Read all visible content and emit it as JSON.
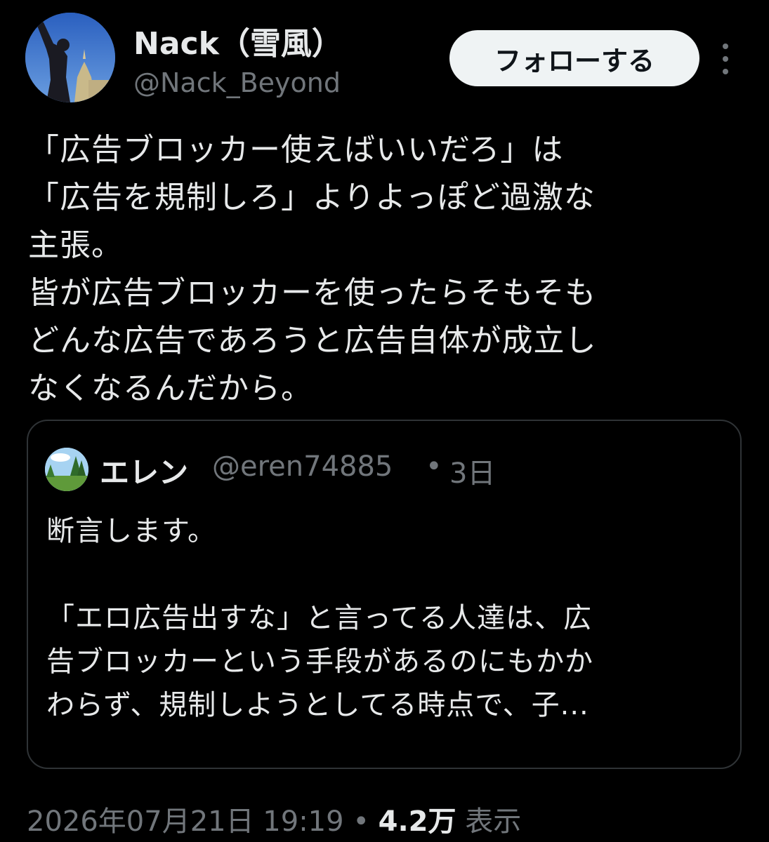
{
  "author": {
    "display_name": "Nack（雪風）",
    "handle": "@Nack_Beyond"
  },
  "follow_button_label": "フォローする",
  "more_icon": "more-vertical-icon",
  "tweet": {
    "lines": [
      "「広告ブロッカー使えばいいだろ」は",
      "「広告を規制しろ」よりよっぽど過激な",
      "主張。",
      "皆が広告ブロッカーを使ったらそもそも",
      "どんな広告であろうと広告自体が成立し",
      "なくなるんだから。"
    ]
  },
  "quote": {
    "display_name": "エレン",
    "handle": "@eren74885",
    "separator": "•",
    "time": "3日",
    "lines": [
      "断言します。",
      "",
      "「エロ広告出すな」と言ってる人達は、広",
      "告ブロッカーという手段があるのにもかか",
      "わらず、規制しようとしてる時点で、子..."
    ]
  },
  "meta": {
    "timestamp": "2026年07月21日 19:19",
    "separator": "•",
    "views_count": "4.2万",
    "views_label": "表示"
  },
  "colors": {
    "background": "#000000",
    "text_primary": "#e7e9ea",
    "text_secondary": "#71767b",
    "border": "#2f3336",
    "follow_button_bg": "#eff3f4"
  }
}
